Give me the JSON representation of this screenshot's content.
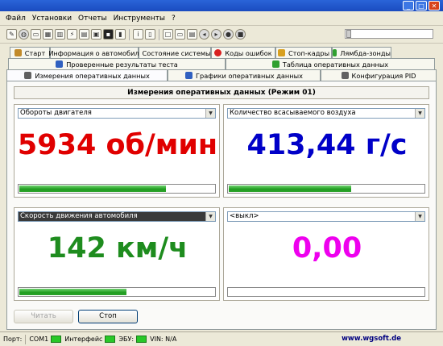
{
  "colors": {
    "rpm": "#e00000",
    "air": "#0000c8",
    "speed": "#1e8c1e",
    "off": "#ee00ee"
  },
  "menu": [
    "Файл",
    "Установки",
    "Отчеты",
    "Инструменты",
    "?"
  ],
  "toolbar_icons": [
    "wrench-icon",
    "globe-icon",
    "card-icon",
    "table-icon",
    "chart-icon",
    "plug-icon",
    "calendar-icon",
    "disk-icon",
    "terminal-icon",
    "battery-icon",
    "info-icon",
    "book-icon",
    "page-icon",
    "folder-icon",
    "print-icon",
    "back-icon",
    "play-icon",
    "record-icon",
    "stop-icon"
  ],
  "tabs": {
    "row1": [
      {
        "label": "Старт",
        "icon": "wrench-icon",
        "color": "#c28a2a"
      },
      {
        "label": "Информация о автомобиле",
        "icon": "car-icon",
        "color": "#d84040"
      },
      {
        "label": "Состояние системы",
        "icon": "monitor-icon",
        "color": "#4a7ac8"
      },
      {
        "label": "Коды ошибок",
        "icon": "error-icon",
        "color": "#d82020"
      },
      {
        "label": "Стоп-кадры",
        "icon": "frame-icon",
        "color": "#d8a020"
      },
      {
        "label": "Лямбда-зонды",
        "icon": "sensor-icon",
        "color": "#30a030"
      }
    ],
    "row2": [
      {
        "label": "Проверенные результаты теста",
        "icon": "check-icon",
        "color": "#3060c0"
      },
      {
        "label": "Таблица оперативных данных",
        "icon": "table-icon",
        "color": "#30a030"
      }
    ],
    "row3": [
      {
        "label": "Измерения оперативных данных",
        "icon": "grid-icon",
        "color": "#606060"
      },
      {
        "label": "Графики оперативных данных",
        "icon": "chart-icon",
        "color": "#3060c0"
      },
      {
        "label": "Конфигурация PID",
        "icon": "config-icon",
        "color": "#606060"
      }
    ]
  },
  "panel_title": "Измерения оперативных данных (Режим 01)",
  "gauges": [
    {
      "select": "Обороты двигателя",
      "value": "5934 об/мин",
      "level": 0.75
    },
    {
      "select": "Количество всасываемого воздуха",
      "value": "413,44 г/с",
      "level": 0.63
    },
    {
      "select": "Скорость движения автомобиля",
      "value": "142 км/ч",
      "level": 0.55
    },
    {
      "select": "<выкл>",
      "value": "0,00",
      "level": 0
    }
  ],
  "buttons": {
    "read": "Читать",
    "stop": "Стоп"
  },
  "status": {
    "port_label": "Порт:",
    "port": "COM1",
    "iface": "Интерфейс",
    "ecu": "ЭБУ:",
    "vin": "VIN: N/A",
    "url": "www.wgsoft.de"
  }
}
